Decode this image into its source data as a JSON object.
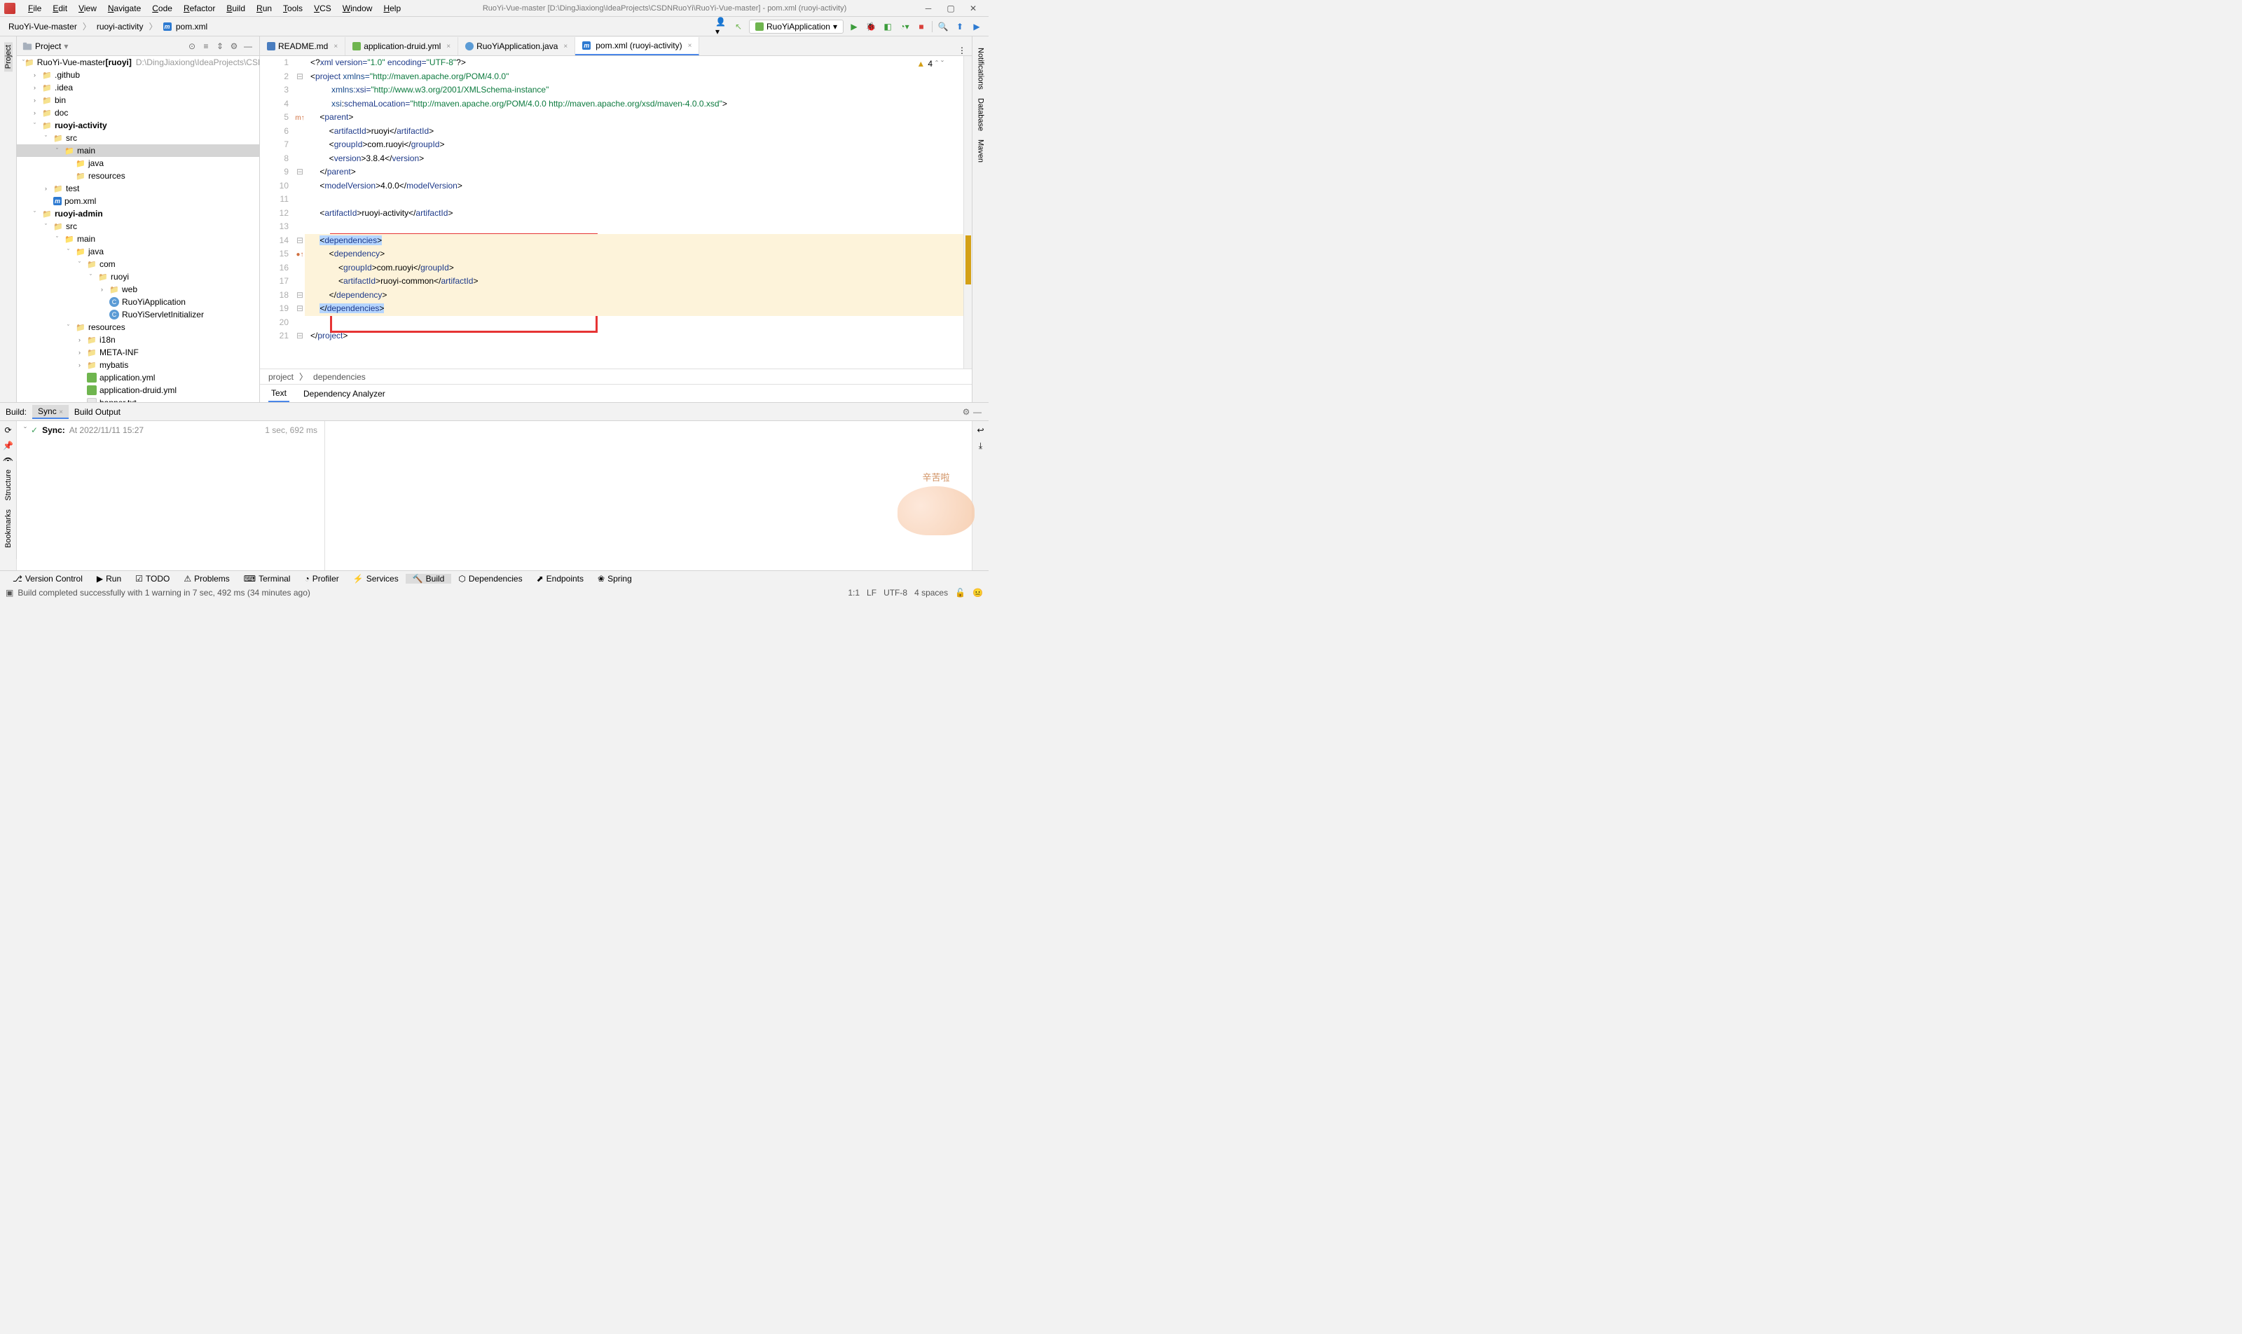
{
  "menu": {
    "items": [
      "File",
      "Edit",
      "View",
      "Navigate",
      "Code",
      "Refactor",
      "Build",
      "Run",
      "Tools",
      "VCS",
      "Window",
      "Help"
    ]
  },
  "window": {
    "title": "RuoYi-Vue-master [D:\\DingJiaxiong\\IdeaProjects\\CSDNRuoYi\\RuoYi-Vue-master] - pom.xml (ruoyi-activity)"
  },
  "breadcrumbs": {
    "items": [
      "RuoYi-Vue-master",
      "ruoyi-activity",
      "pom.xml"
    ],
    "file_icon": "m"
  },
  "run_config": {
    "name": "RuoYiApplication"
  },
  "project_panel": {
    "title": "Project"
  },
  "tree": [
    {
      "d": 0,
      "a": "v",
      "i": "folder",
      "l": "RuoYi-Vue-master",
      "b": "[ruoyi]",
      "p": "D:\\DingJiaxiong\\IdeaProjects\\CSDN"
    },
    {
      "d": 1,
      "a": ">",
      "i": "folder",
      "l": ".github"
    },
    {
      "d": 1,
      "a": ">",
      "i": "folder",
      "l": ".idea"
    },
    {
      "d": 1,
      "a": ">",
      "i": "folder",
      "l": "bin"
    },
    {
      "d": 1,
      "a": ">",
      "i": "folder",
      "l": "doc"
    },
    {
      "d": 1,
      "a": "v",
      "i": "folder",
      "l": "ruoyi-activity",
      "bold": true
    },
    {
      "d": 2,
      "a": "v",
      "i": "folder",
      "l": "src"
    },
    {
      "d": 3,
      "a": "v",
      "i": "folder-blue",
      "l": "main",
      "sel": true
    },
    {
      "d": 4,
      "a": "",
      "i": "folder-blue",
      "l": "java"
    },
    {
      "d": 4,
      "a": "",
      "i": "folder",
      "l": "resources"
    },
    {
      "d": 2,
      "a": ">",
      "i": "folder",
      "l": "test"
    },
    {
      "d": 2,
      "a": "",
      "i": "m",
      "l": "pom.xml"
    },
    {
      "d": 1,
      "a": "v",
      "i": "folder",
      "l": "ruoyi-admin",
      "bold": true
    },
    {
      "d": 2,
      "a": "v",
      "i": "folder",
      "l": "src"
    },
    {
      "d": 3,
      "a": "v",
      "i": "folder-blue",
      "l": "main"
    },
    {
      "d": 4,
      "a": "v",
      "i": "folder-blue",
      "l": "java"
    },
    {
      "d": 5,
      "a": "v",
      "i": "folder",
      "l": "com"
    },
    {
      "d": 6,
      "a": "v",
      "i": "folder",
      "l": "ruoyi"
    },
    {
      "d": 7,
      "a": ">",
      "i": "folder",
      "l": "web"
    },
    {
      "d": 7,
      "a": "",
      "i": "class",
      "l": "RuoYiApplication"
    },
    {
      "d": 7,
      "a": "",
      "i": "class",
      "l": "RuoYiServletInitializer"
    },
    {
      "d": 4,
      "a": "v",
      "i": "folder",
      "l": "resources"
    },
    {
      "d": 5,
      "a": ">",
      "i": "folder",
      "l": "i18n"
    },
    {
      "d": 5,
      "a": ">",
      "i": "folder",
      "l": "META-INF"
    },
    {
      "d": 5,
      "a": ">",
      "i": "folder",
      "l": "mybatis"
    },
    {
      "d": 5,
      "a": "",
      "i": "yml",
      "l": "application.yml"
    },
    {
      "d": 5,
      "a": "",
      "i": "yml",
      "l": "application-druid.yml"
    },
    {
      "d": 5,
      "a": "",
      "i": "txt",
      "l": "banner.txt"
    }
  ],
  "editor_tabs": [
    {
      "label": "README.md",
      "icon": "md"
    },
    {
      "label": "application-druid.yml",
      "icon": "yml"
    },
    {
      "label": "RuoYiApplication.java",
      "icon": "class"
    },
    {
      "label": "pom.xml (ruoyi-activity)",
      "icon": "m",
      "active": true
    }
  ],
  "warnings": {
    "count": "4"
  },
  "code": {
    "lines": [
      {
        "n": 1,
        "segs": [
          [
            "<?",
            "txt"
          ],
          [
            "xml version=",
            "tag"
          ],
          [
            "\"1.0\"",
            "str"
          ],
          [
            " encoding=",
            "tag"
          ],
          [
            "\"UTF-8\"",
            "str"
          ],
          [
            "?>",
            "txt"
          ]
        ]
      },
      {
        "n": 2,
        "fold": "-",
        "segs": [
          [
            "<",
            "txt"
          ],
          [
            "project ",
            "tag"
          ],
          [
            "xmlns=",
            "attr"
          ],
          [
            "\"http://maven.apache.org/POM/4.0.0\"",
            "str"
          ]
        ]
      },
      {
        "n": 3,
        "segs": [
          [
            "         ",
            "txt"
          ],
          [
            "xmlns:",
            "attr"
          ],
          [
            "xsi=",
            "tag"
          ],
          [
            "\"http://www.w3.org/2001/XMLSchema-instance\"",
            "str"
          ]
        ]
      },
      {
        "n": 4,
        "segs": [
          [
            "         ",
            "txt"
          ],
          [
            "xsi",
            "attr"
          ],
          [
            ":",
            "txt"
          ],
          [
            "schemaLocation=",
            "tag"
          ],
          [
            "\"http://maven.apache.org/POM/4.0.0 http://maven.apache.org/xsd/maven-4.0.0.xsd\"",
            "str"
          ],
          [
            ">",
            "txt"
          ]
        ]
      },
      {
        "n": 5,
        "fold": "-",
        "mark": "m↑",
        "segs": [
          [
            "    <",
            "txt"
          ],
          [
            "parent",
            "tag"
          ],
          [
            ">",
            "txt"
          ]
        ]
      },
      {
        "n": 6,
        "segs": [
          [
            "        <",
            "txt"
          ],
          [
            "artifactId",
            "tag"
          ],
          [
            ">",
            "txt"
          ],
          [
            "ruoyi",
            "txt"
          ],
          [
            "</",
            "txt"
          ],
          [
            "artifactId",
            "tag"
          ],
          [
            ">",
            "txt"
          ]
        ]
      },
      {
        "n": 7,
        "segs": [
          [
            "        <",
            "txt"
          ],
          [
            "groupId",
            "tag"
          ],
          [
            ">",
            "txt"
          ],
          [
            "com.ruoyi",
            "txt"
          ],
          [
            "</",
            "txt"
          ],
          [
            "groupId",
            "tag"
          ],
          [
            ">",
            "txt"
          ]
        ]
      },
      {
        "n": 8,
        "segs": [
          [
            "        <",
            "txt"
          ],
          [
            "version",
            "tag"
          ],
          [
            ">",
            "txt"
          ],
          [
            "3.8.4",
            "txt"
          ],
          [
            "</",
            "txt"
          ],
          [
            "version",
            "tag"
          ],
          [
            ">",
            "txt"
          ]
        ]
      },
      {
        "n": 9,
        "fold": "-",
        "segs": [
          [
            "    </",
            "txt"
          ],
          [
            "parent",
            "tag"
          ],
          [
            ">",
            "txt"
          ]
        ]
      },
      {
        "n": 10,
        "segs": [
          [
            "    <",
            "txt"
          ],
          [
            "modelVersion",
            "tag"
          ],
          [
            ">",
            "txt"
          ],
          [
            "4.0.0",
            "txt"
          ],
          [
            "</",
            "txt"
          ],
          [
            "modelVersion",
            "tag"
          ],
          [
            ">",
            "txt"
          ]
        ]
      },
      {
        "n": 11,
        "segs": [
          [
            "",
            "txt"
          ]
        ]
      },
      {
        "n": 12,
        "segs": [
          [
            "    <",
            "txt"
          ],
          [
            "artifactId",
            "tag"
          ],
          [
            ">",
            "txt"
          ],
          [
            "ruoyi-activity",
            "txt"
          ],
          [
            "</",
            "txt"
          ],
          [
            "artifactId",
            "tag"
          ],
          [
            ">",
            "txt"
          ]
        ]
      },
      {
        "n": 13,
        "segs": [
          [
            "",
            "txt"
          ]
        ]
      },
      {
        "n": 14,
        "fold": "-",
        "hl": true,
        "segs": [
          [
            "    ",
            "txt"
          ],
          [
            "<",
            "txt",
            true
          ],
          [
            "dependencies",
            "tag",
            true
          ],
          [
            ">",
            "txt",
            true
          ]
        ]
      },
      {
        "n": 15,
        "fold": "-",
        "mark": "●↑",
        "hl": true,
        "segs": [
          [
            "        <",
            "txt"
          ],
          [
            "dependency",
            "tag"
          ],
          [
            ">",
            "txt"
          ]
        ]
      },
      {
        "n": 16,
        "hl": true,
        "segs": [
          [
            "            <",
            "txt"
          ],
          [
            "groupId",
            "tag"
          ],
          [
            ">",
            "txt"
          ],
          [
            "com.ruoyi",
            "txt"
          ],
          [
            "</",
            "txt"
          ],
          [
            "groupId",
            "tag"
          ],
          [
            ">",
            "txt"
          ]
        ]
      },
      {
        "n": 17,
        "hl": true,
        "segs": [
          [
            "            <",
            "txt"
          ],
          [
            "artifactId",
            "tag"
          ],
          [
            ">",
            "txt"
          ],
          [
            "ruoyi-common",
            "txt"
          ],
          [
            "</",
            "txt"
          ],
          [
            "artifactId",
            "tag"
          ],
          [
            ">",
            "txt"
          ]
        ]
      },
      {
        "n": 18,
        "fold": "-",
        "hl": true,
        "segs": [
          [
            "        </",
            "txt"
          ],
          [
            "dependency",
            "tag"
          ],
          [
            ">",
            "txt"
          ]
        ]
      },
      {
        "n": 19,
        "fold": "-",
        "hl": true,
        "segs": [
          [
            "    ",
            "txt"
          ],
          [
            "</",
            "txt",
            true
          ],
          [
            "dependencies",
            "tag",
            true
          ],
          [
            ">",
            "txt",
            true
          ]
        ]
      },
      {
        "n": 20,
        "segs": [
          [
            "",
            "txt"
          ]
        ]
      },
      {
        "n": 21,
        "fold": "-",
        "segs": [
          [
            "</",
            "txt"
          ],
          [
            "project",
            "tag"
          ],
          [
            ">",
            "txt"
          ]
        ]
      }
    ]
  },
  "editor_breadcrumb": {
    "items": [
      "project",
      "dependencies"
    ]
  },
  "editor_subtabs": [
    {
      "l": "Text",
      "active": true
    },
    {
      "l": "Dependency Analyzer"
    }
  ],
  "build": {
    "label": "Build:",
    "tabs": [
      {
        "l": "Sync",
        "active": true
      },
      {
        "l": "Build Output"
      }
    ],
    "sync_label": "Sync:",
    "sync_time": "At 2022/11/11 15:27",
    "duration": "1 sec, 692 ms"
  },
  "bottom_bar": [
    {
      "l": "Version Control",
      "i": "branch"
    },
    {
      "l": "Run",
      "i": "play"
    },
    {
      "l": "TODO",
      "i": "todo"
    },
    {
      "l": "Problems",
      "i": "warn"
    },
    {
      "l": "Terminal",
      "i": "term"
    },
    {
      "l": "Profiler",
      "i": "prof"
    },
    {
      "l": "Services",
      "i": "svc"
    },
    {
      "l": "Build",
      "i": "hammer",
      "active": true
    },
    {
      "l": "Dependencies",
      "i": "dep"
    },
    {
      "l": "Endpoints",
      "i": "ep"
    },
    {
      "l": "Spring",
      "i": "spring"
    }
  ],
  "status": {
    "message": "Build completed successfully with 1 warning in 7 sec, 492 ms (34 minutes ago)",
    "position": "1:1",
    "line_sep": "LF",
    "encoding": "UTF-8",
    "indent": "4 spaces"
  },
  "left_rail": {
    "items": [
      "Project"
    ]
  },
  "left_bottom_rail": {
    "items": [
      "Structure",
      "Bookmarks"
    ]
  },
  "right_rail": {
    "items": [
      "Notifications",
      "Database",
      "Maven"
    ]
  },
  "mascot": {
    "text": "辛苦啦"
  }
}
